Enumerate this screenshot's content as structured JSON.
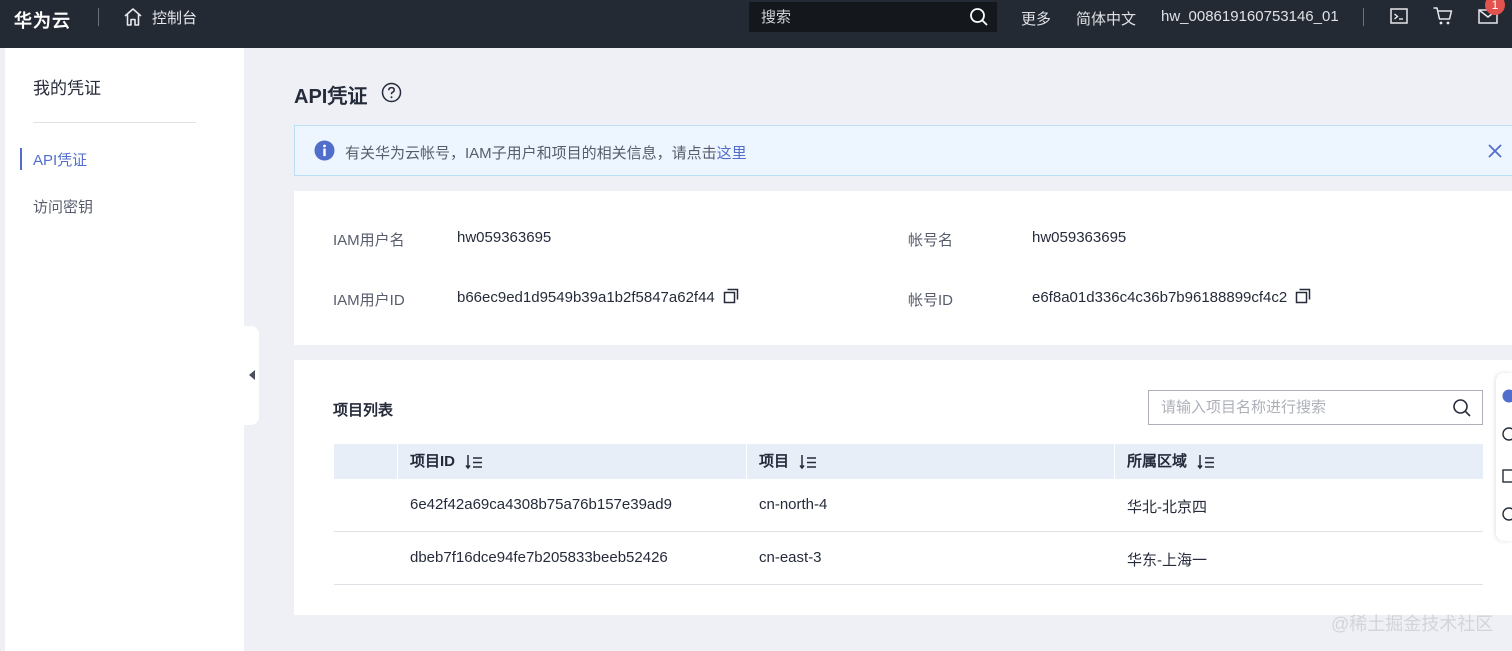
{
  "topbar": {
    "brand": "华为云",
    "console_label": "控制台",
    "search_placeholder": "搜索",
    "more_label": "更多",
    "lang_label": "简体中文",
    "username": "hw_008619160753146_01",
    "mail_badge": "1"
  },
  "sidebar": {
    "title": "我的凭证",
    "items": [
      {
        "label": "API凭证",
        "active": true
      },
      {
        "label": "访问密钥",
        "active": false
      }
    ]
  },
  "page": {
    "title": "API凭证"
  },
  "alert": {
    "text": "有关华为云帐号，IAM子用户和项目的相关信息，请点击",
    "link": "这里"
  },
  "info": {
    "iam_user_label": "IAM用户名",
    "iam_user_value": "hw059363695",
    "iam_id_label": "IAM用户ID",
    "iam_id_value": "b66ec9ed1d9549b39a1b2f5847a62f44",
    "account_label": "帐号名",
    "account_value": "hw059363695",
    "account_id_label": "帐号ID",
    "account_id_value": "e6f8a01d336c4c36b7b96188899cf4c2"
  },
  "projects": {
    "title": "项目列表",
    "search_placeholder": "请输入项目名称进行搜索",
    "columns": [
      "项目ID",
      "项目",
      "所属区域"
    ],
    "rows": [
      [
        "6e42f42a69ca4308b75a76b157e39ad9",
        "cn-north-4",
        "华北-北京四"
      ],
      [
        "dbeb7f16dce94fe7b205833beeb52426",
        "cn-east-3",
        "华东-上海一"
      ]
    ]
  },
  "watermark": "@稀土掘金技术社区",
  "colors": {
    "accent": "#526ecc",
    "topbar": "#242a33",
    "page_bg": "#eef0f5",
    "alert_bg": "#edf6ff"
  }
}
